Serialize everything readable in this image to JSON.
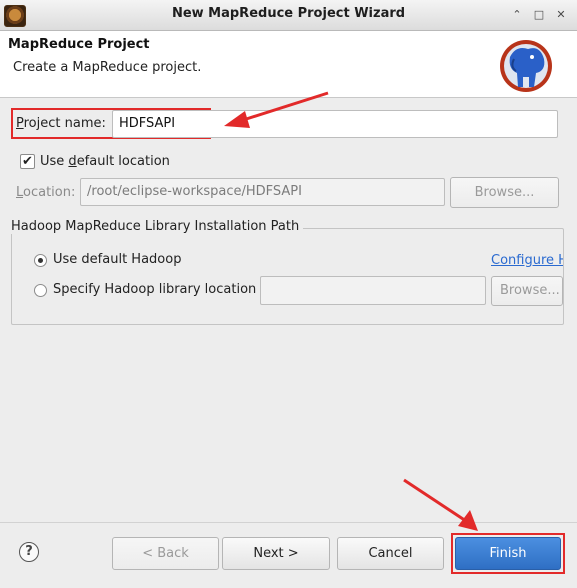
{
  "window": {
    "title": "New MapReduce Project Wizard",
    "controls": {
      "minimize": "⌃",
      "restore": "□",
      "close": "✕"
    }
  },
  "header": {
    "title": "MapReduce Project",
    "description": "Create a MapReduce project."
  },
  "project_name": {
    "label_first": "P",
    "label_rest": "roject name:",
    "value": "HDFSAPI"
  },
  "use_default_location": {
    "checked": true,
    "label_prefix": "Use ",
    "label_accel": "d",
    "label_rest": "efault location"
  },
  "location": {
    "label_accel": "L",
    "label_rest": "ocation:",
    "value": "/root/eclipse-workspace/HDFSAPI",
    "browse_label": "Browse..."
  },
  "hadoop_group": {
    "title": "Hadoop MapReduce Library Installation Path",
    "use_default_label": "Use default Hadoop",
    "configure_link": "Configure H",
    "specify_label": "Specify Hadoop library location",
    "specify_value": "",
    "browse_label": "Browse..."
  },
  "footer": {
    "help": "?",
    "back_label": "< Back",
    "next_label": "Next >",
    "cancel_label": "Cancel",
    "finish_label": "Finish"
  },
  "colors": {
    "annotation_red": "#e22a2a",
    "finish_blue": "#3b7dd8",
    "link_blue": "#2a6ad0"
  }
}
